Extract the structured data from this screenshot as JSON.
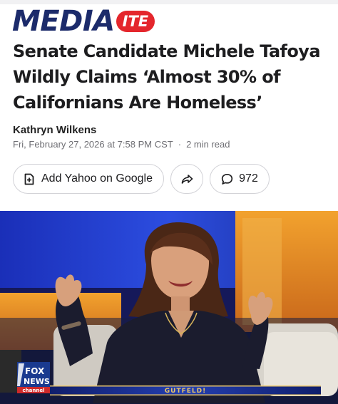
{
  "brand": {
    "logo_text": "MEDIA",
    "logo_badge": "ITE"
  },
  "article": {
    "headline_lines": [
      "Senate Candidate Michele Tafoya",
      "Wildly Claims ‘Almost 30% of",
      "Californians Are Homeless’"
    ],
    "author": "Kathryn Wilkens",
    "timestamp": "Fri, February 27, 2026 at 7:58 PM CST",
    "separator": "·",
    "read_time": "2 min read"
  },
  "actions": {
    "google_label": "Add Yahoo on Google",
    "comments_count": "972"
  },
  "video": {
    "network_logo_line1": "FOX",
    "network_logo_line2": "NEWS",
    "network_logo_line3": "channel",
    "ticker_text": "GUTFELD!"
  },
  "colors": {
    "logo_navy": "#1c2b6b",
    "logo_red": "#e4262c",
    "studio_blue": "#1f3fd0",
    "studio_orange": "#e0831e"
  }
}
